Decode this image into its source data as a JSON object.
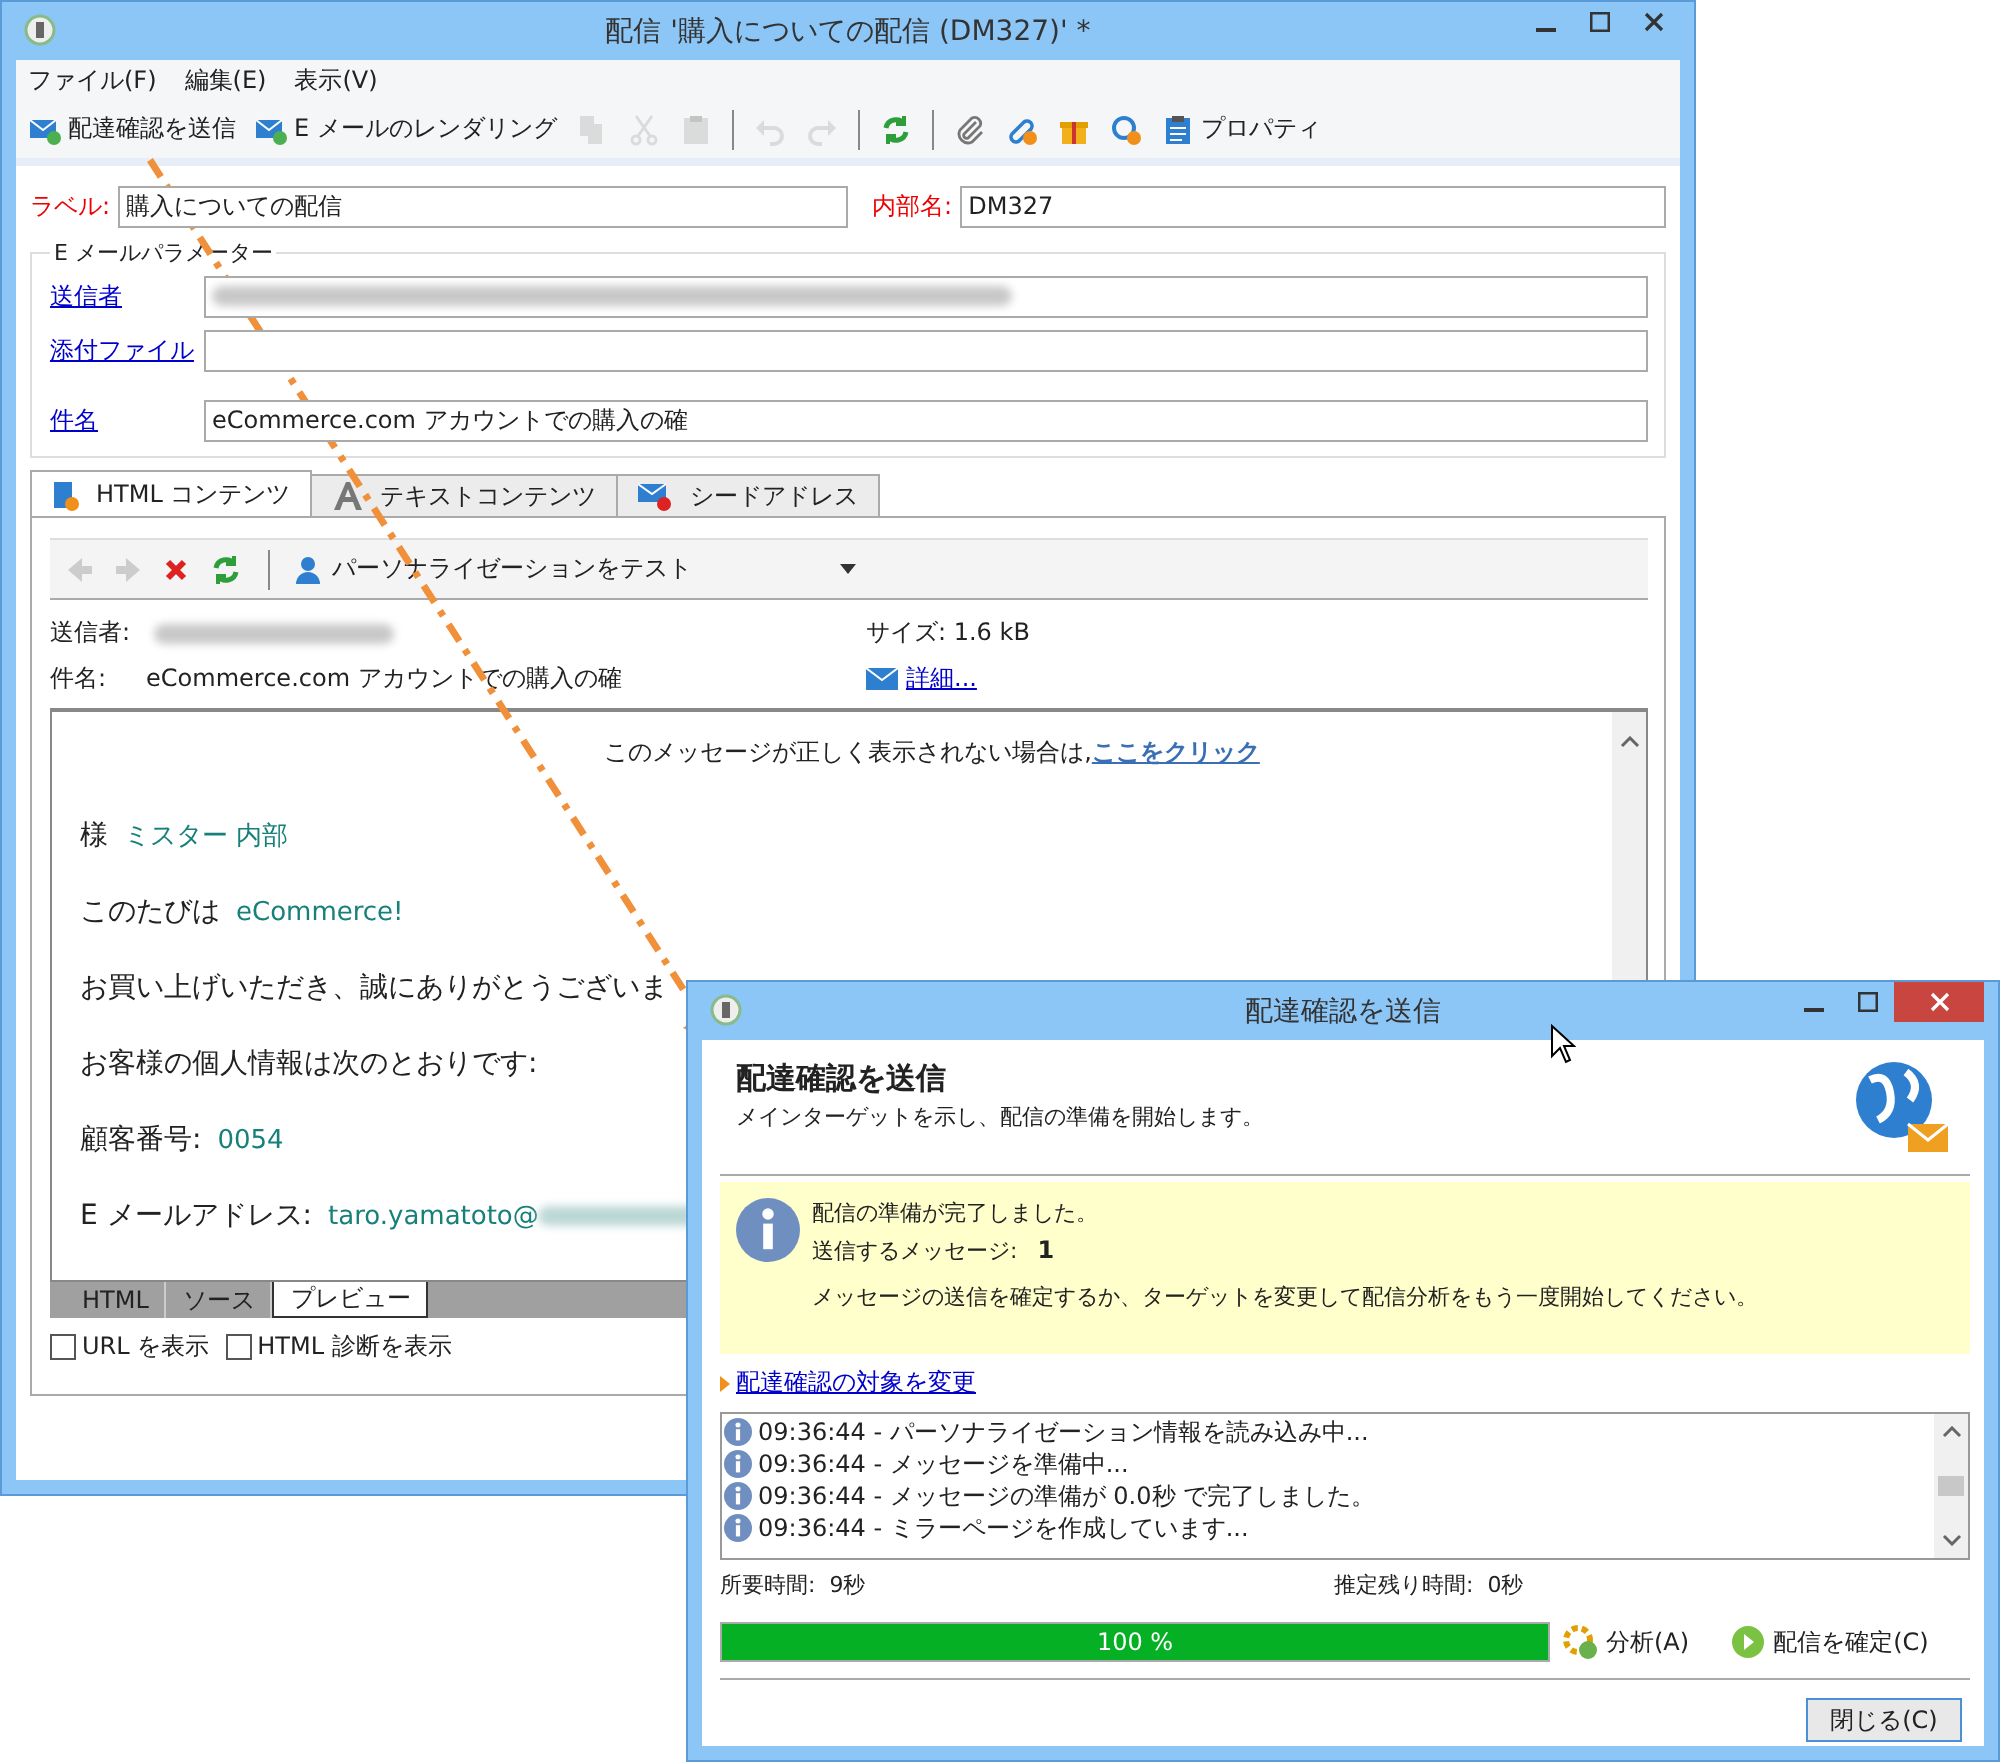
{
  "main_window": {
    "title": "配信 '購入についての配信 (DM327)' *",
    "menu": [
      "ファイル(F)",
      "編集(E)",
      "表示(V)"
    ],
    "toolbar": [
      {
        "kind": "send",
        "label": "配達確認を送信",
        "disabled": false
      },
      {
        "kind": "render",
        "label": "E メールのレンダリング",
        "disabled": false
      },
      {
        "kind": "copy",
        "disabled": true
      },
      {
        "kind": "cut",
        "disabled": true
      },
      {
        "kind": "paste",
        "disabled": true
      },
      {
        "kind": "separator"
      },
      {
        "kind": "undo",
        "disabled": true
      },
      {
        "kind": "redo",
        "disabled": true
      },
      {
        "kind": "separator"
      },
      {
        "kind": "refresh",
        "disabled": false
      },
      {
        "kind": "separator"
      },
      {
        "kind": "attach",
        "disabled": false
      },
      {
        "kind": "link",
        "disabled": false
      },
      {
        "kind": "gift",
        "disabled": false
      },
      {
        "kind": "tracking",
        "disabled": false
      },
      {
        "kind": "properties",
        "label": "プロパティ",
        "disabled": false
      }
    ],
    "label_field": {
      "label": "ラベル:",
      "value": "購入についての配信"
    },
    "internal_name_field": {
      "label": "内部名:",
      "value": "DM327"
    },
    "email_parameters": {
      "title": "E メールパラメーター",
      "rows": [
        {
          "label": "送信者",
          "value": "",
          "redacted": true
        },
        {
          "label": "添付ファイル",
          "value": ""
        },
        {
          "label": "件名",
          "value": "eCommerce.com アカウントでの購入の確"
        }
      ]
    },
    "tabs": [
      {
        "kind": "html",
        "label": "HTML コンテンツ",
        "selected": true
      },
      {
        "kind": "text",
        "label": "テキストコンテンツ",
        "selected": false
      },
      {
        "kind": "seed",
        "label": "シードアドレス",
        "selected": false
      }
    ],
    "preview_toolbar": {
      "personalization": "パーソナライゼーションをテスト"
    },
    "message_info": {
      "sender_label": "送信者:",
      "size": "サイズ: 1.6 kB",
      "subject_label": "件名:",
      "subject": "eCommerce.com アカウントでの購入の確",
      "details_link": "詳細..."
    },
    "preview": {
      "notice": "このメッセージが正しく表示されない場合は,",
      "notice_link": "ここをクリック",
      "lines": [
        {
          "label": "様",
          "value": "ミスター 内部"
        },
        {
          "label": "このたびは",
          "value": "eCommerce!"
        },
        {
          "label": "お買い上げいただき、誠にありがとうございま"
        },
        {
          "label": "お客様の個人情報は次のとおりです:"
        },
        {
          "label": "顧客番号:",
          "value": "0054"
        },
        {
          "label": "E メールアドレス:",
          "value": "taro.yamatoto@",
          "redacted": true
        }
      ]
    },
    "view_tabs": [
      {
        "label": "HTML",
        "selected": false
      },
      {
        "label": "ソース",
        "selected": false
      },
      {
        "label": "プレビュー",
        "selected": true
      }
    ],
    "options": [
      {
        "label": "URL を表示",
        "checked": false
      },
      {
        "label": "HTML 診断を表示",
        "checked": false
      }
    ]
  },
  "dialog": {
    "title": "配達確認を送信",
    "heading": "配達確認を送信",
    "subtitle": "メインターゲットを示し、配信の準備を開始します。",
    "info": {
      "status": "配信の準備が完了しました。",
      "count_label": "送信するメッセージ:",
      "count": "1",
      "instruction": "メッセージの送信を確定するか、ターゲットを変更して配信分析をもう一度開始してください。"
    },
    "change_target_link": "配達確認の対象を変更",
    "log": [
      "09:36:44 - パーソナライゼーション情報を読み込み中...",
      "09:36:44 - メッセージを準備中...",
      "09:36:44 - メッセージの準備が 0.0秒 で完了しました。",
      "09:36:44 - ミラーページを作成しています..."
    ],
    "elapsed": "所要時間:  9秒",
    "remaining": "推定残り時間:  0秒",
    "progress": {
      "level": 1,
      "reading": "100 %"
    },
    "analyze_button": "分析(A)",
    "confirm_button": "配信を確定(C)",
    "close_button": "閉じる(C)"
  }
}
